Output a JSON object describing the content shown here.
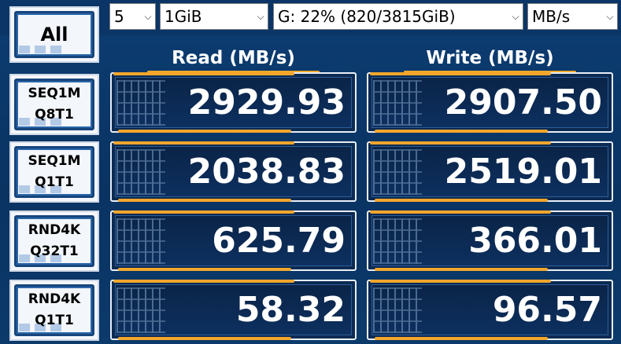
{
  "controls": {
    "runs": "5",
    "size": "1GiB",
    "drive": "G: 22% (820/3815GiB)",
    "unit": "MB/s"
  },
  "all_button": "All",
  "headers": {
    "read": "Read (MB/s)",
    "write": "Write (MB/s)"
  },
  "tests": [
    {
      "line1": "SEQ1M",
      "line2": "Q8T1",
      "read": "2929.93",
      "write": "2907.50"
    },
    {
      "line1": "SEQ1M",
      "line2": "Q1T1",
      "read": "2038.83",
      "write": "2519.01"
    },
    {
      "line1": "RND4K",
      "line2": "Q32T1",
      "read": "625.79",
      "write": "366.01"
    },
    {
      "line1": "RND4K",
      "line2": "Q1T1",
      "read": "58.32",
      "write": "96.57"
    }
  ],
  "colors": {
    "background": "#0a3566",
    "accent_orange": "#f2a62b",
    "value_text": "#ffffff"
  }
}
